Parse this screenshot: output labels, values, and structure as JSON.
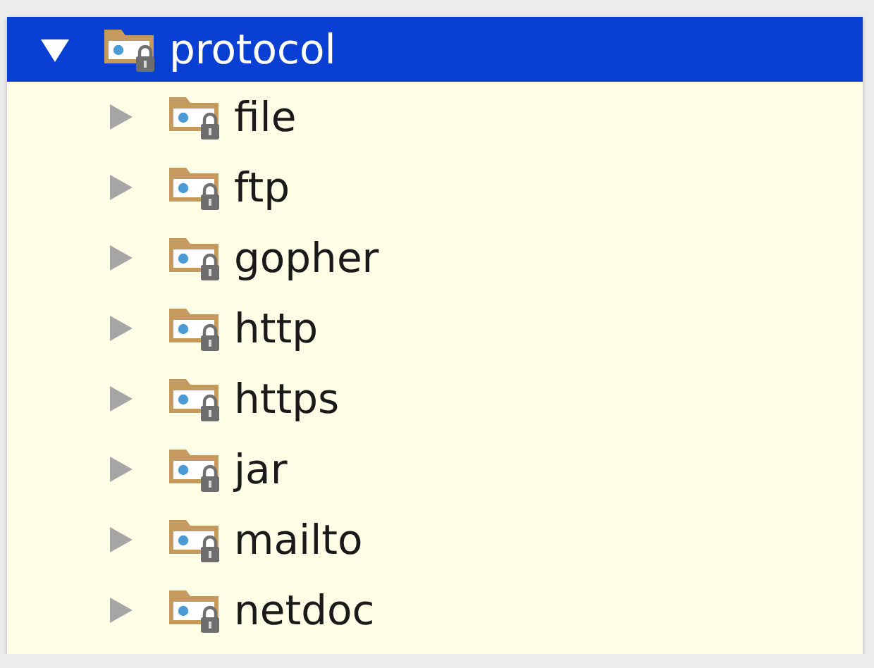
{
  "tree": [
    {
      "label": "protocol",
      "expanded": true,
      "selected": true,
      "children": [
        {
          "label": "file",
          "expanded": false,
          "selected": false
        },
        {
          "label": "ftp",
          "expanded": false,
          "selected": false
        },
        {
          "label": "gopher",
          "expanded": false,
          "selected": false
        },
        {
          "label": "http",
          "expanded": false,
          "selected": false
        },
        {
          "label": "https",
          "expanded": false,
          "selected": false
        },
        {
          "label": "jar",
          "expanded": false,
          "selected": false
        },
        {
          "label": "mailto",
          "expanded": false,
          "selected": false
        },
        {
          "label": "netdoc",
          "expanded": false,
          "selected": false
        }
      ]
    }
  ]
}
